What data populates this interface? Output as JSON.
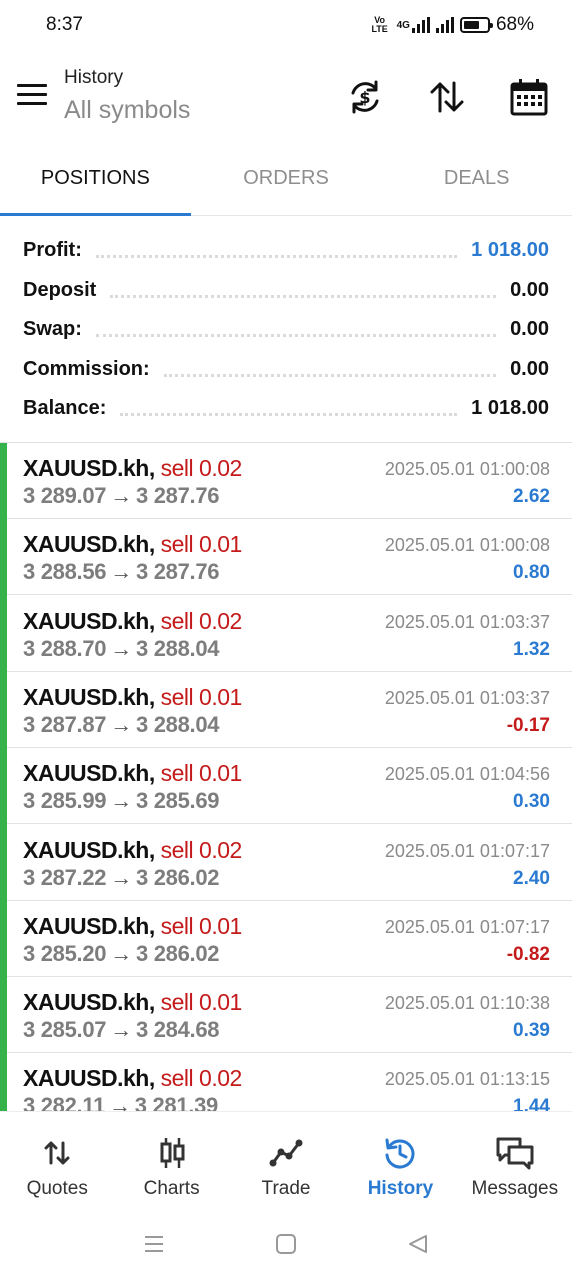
{
  "status_bar": {
    "time": "8:37",
    "volte": "Vo LTE",
    "network": "4G",
    "battery": "68%",
    "battery_level": 0.68
  },
  "header": {
    "title": "History",
    "subtitle": "All symbols",
    "icons": [
      "menu-icon",
      "currency-sync-icon",
      "sort-icon",
      "calendar-icon"
    ]
  },
  "tabs": [
    {
      "label": "POSITIONS",
      "active": true
    },
    {
      "label": "ORDERS",
      "active": false
    },
    {
      "label": "DEALS",
      "active": false
    }
  ],
  "summary": [
    {
      "label": "Profit:",
      "value": "1 018.00",
      "highlight": true
    },
    {
      "label": "Deposit",
      "value": "0.00",
      "highlight": false
    },
    {
      "label": "Swap:",
      "value": "0.00",
      "highlight": false
    },
    {
      "label": "Commission:",
      "value": "0.00",
      "highlight": false
    },
    {
      "label": "Balance:",
      "value": "1 018.00",
      "highlight": false
    }
  ],
  "positions": [
    {
      "symbol": "XAUUSD.kh,",
      "side": "sell 0.02",
      "open": "3 289.07",
      "close": "3 287.76",
      "time": "2025.05.01 01:00:08",
      "profit": "2.62",
      "positive": true
    },
    {
      "symbol": "XAUUSD.kh,",
      "side": "sell 0.01",
      "open": "3 288.56",
      "close": "3 287.76",
      "time": "2025.05.01 01:00:08",
      "profit": "0.80",
      "positive": true
    },
    {
      "symbol": "XAUUSD.kh,",
      "side": "sell 0.02",
      "open": "3 288.70",
      "close": "3 288.04",
      "time": "2025.05.01 01:03:37",
      "profit": "1.32",
      "positive": true
    },
    {
      "symbol": "XAUUSD.kh,",
      "side": "sell 0.01",
      "open": "3 287.87",
      "close": "3 288.04",
      "time": "2025.05.01 01:03:37",
      "profit": "-0.17",
      "positive": false
    },
    {
      "symbol": "XAUUSD.kh,",
      "side": "sell 0.01",
      "open": "3 285.99",
      "close": "3 285.69",
      "time": "2025.05.01 01:04:56",
      "profit": "0.30",
      "positive": true
    },
    {
      "symbol": "XAUUSD.kh,",
      "side": "sell 0.02",
      "open": "3 287.22",
      "close": "3 286.02",
      "time": "2025.05.01 01:07:17",
      "profit": "2.40",
      "positive": true
    },
    {
      "symbol": "XAUUSD.kh,",
      "side": "sell 0.01",
      "open": "3 285.20",
      "close": "3 286.02",
      "time": "2025.05.01 01:07:17",
      "profit": "-0.82",
      "positive": false
    },
    {
      "symbol": "XAUUSD.kh,",
      "side": "sell 0.01",
      "open": "3 285.07",
      "close": "3 284.68",
      "time": "2025.05.01 01:10:38",
      "profit": "0.39",
      "positive": true
    },
    {
      "symbol": "XAUUSD.kh,",
      "side": "sell 0.02",
      "open": "3 282.11",
      "close": "3 281.39",
      "time": "2025.05.01 01:13:15",
      "profit": "1.44",
      "positive": true
    }
  ],
  "arrow": "→",
  "bottom_nav": [
    {
      "label": "Quotes",
      "icon": "quotes-icon",
      "active": false
    },
    {
      "label": "Charts",
      "icon": "charts-icon",
      "active": false
    },
    {
      "label": "Trade",
      "icon": "trade-icon",
      "active": false
    },
    {
      "label": "History",
      "icon": "history-icon",
      "active": true
    },
    {
      "label": "Messages",
      "icon": "messages-icon",
      "active": false
    }
  ],
  "colors": {
    "accent": "#2a7ad1",
    "sell": "#c41a1a",
    "loss": "#c41a1a",
    "profit": "#2a7ad1",
    "row_marker": "#35b34a"
  }
}
